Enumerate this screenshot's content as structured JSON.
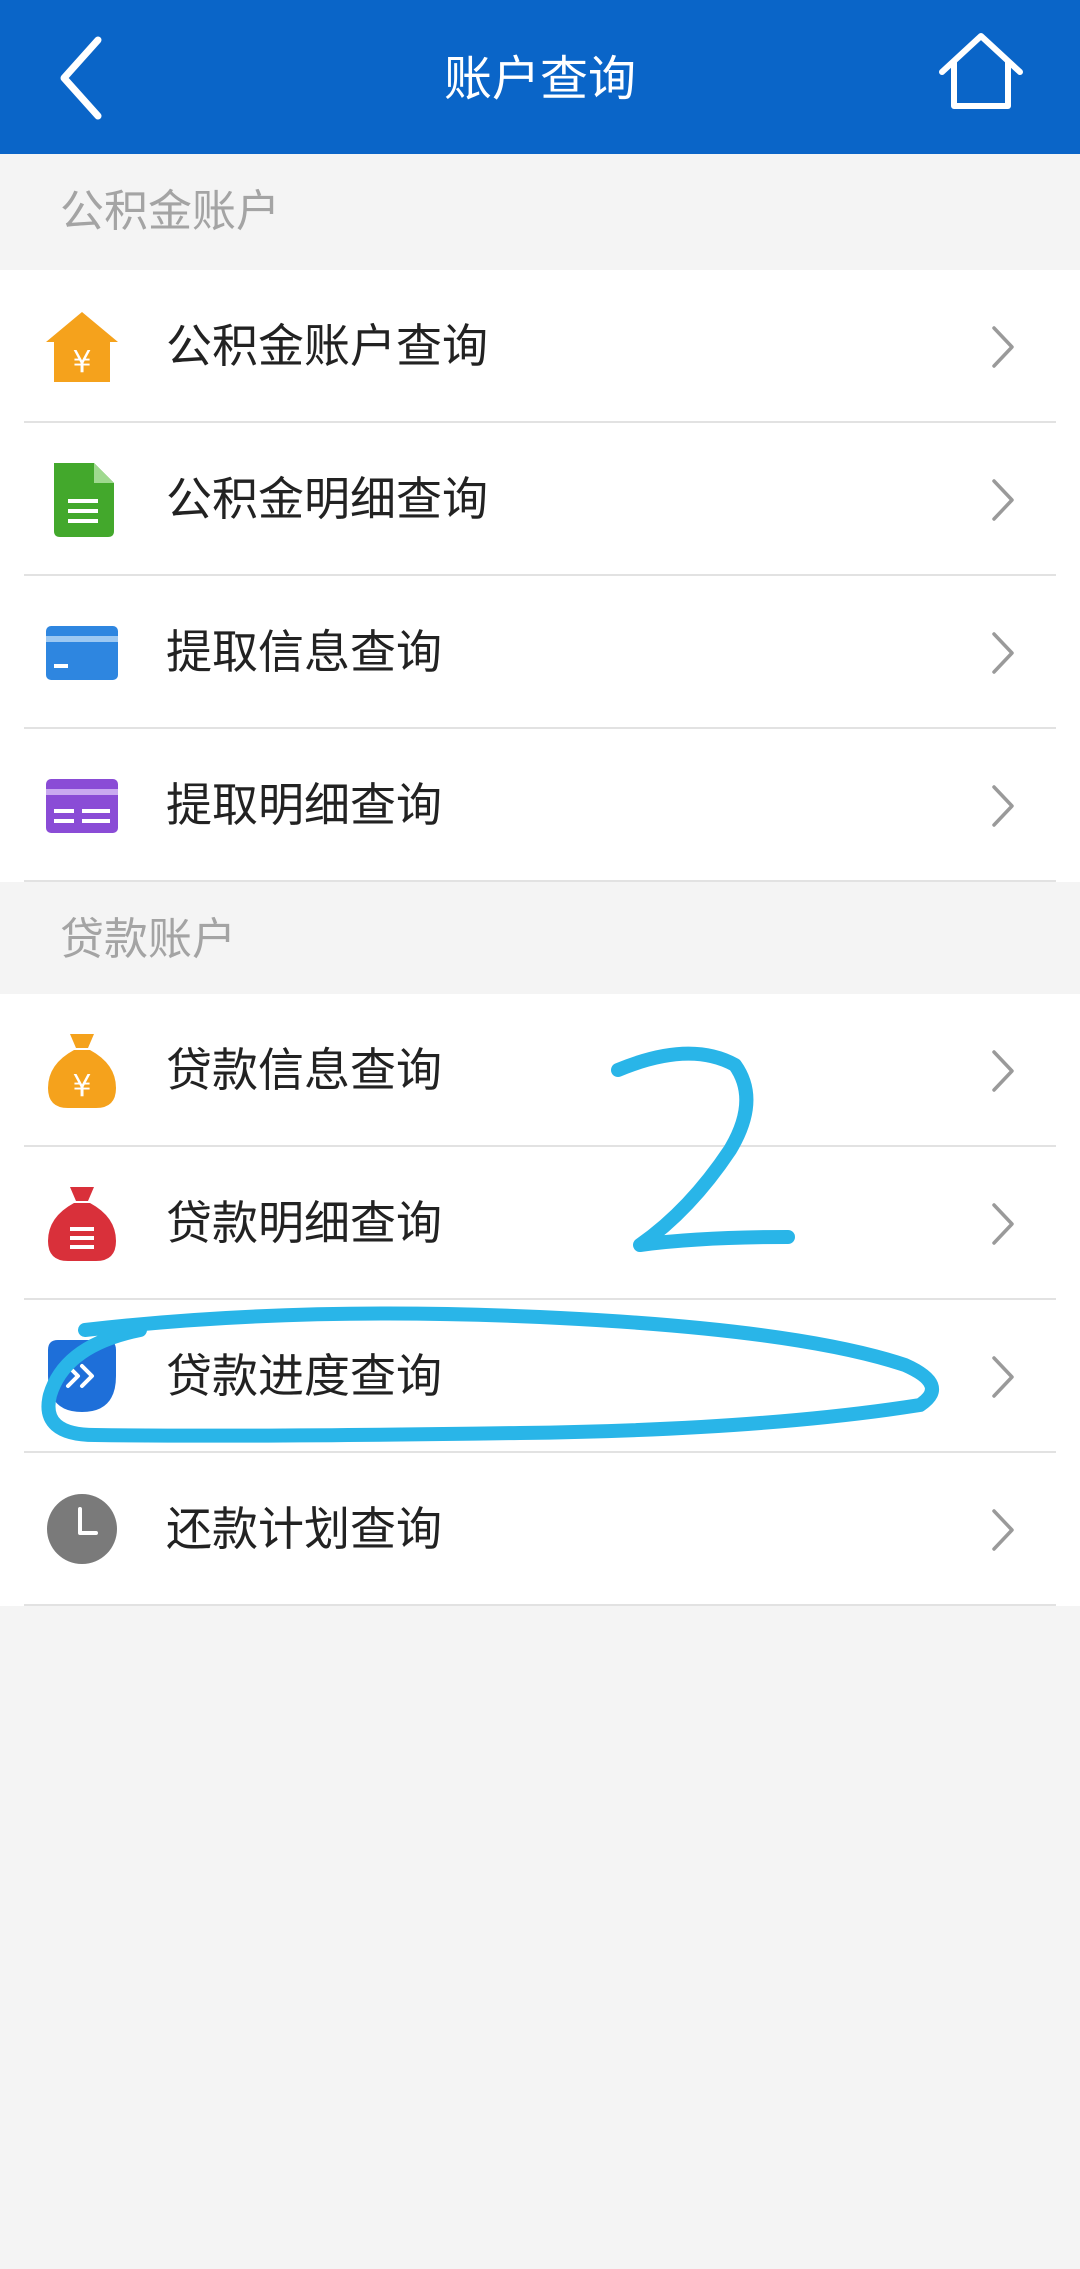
{
  "header": {
    "title": "账户查询"
  },
  "sections": [
    {
      "title": "公积金账户",
      "items": [
        {
          "label": "公积金账户查询",
          "icon": "house-yen-icon",
          "color": "#f5a21c"
        },
        {
          "label": "公积金明细查询",
          "icon": "document-icon",
          "color": "#43a82c"
        },
        {
          "label": "提取信息查询",
          "icon": "card-icon",
          "color": "#2e86e0"
        },
        {
          "label": "提取明细查询",
          "icon": "card-detail-icon",
          "color": "#8a4cd6"
        }
      ]
    },
    {
      "title": "贷款账户",
      "items": [
        {
          "label": "贷款信息查询",
          "icon": "money-bag-yen-icon",
          "color": "#f5a21c"
        },
        {
          "label": "贷款明细查询",
          "icon": "money-bag-list-icon",
          "color": "#d9303a"
        },
        {
          "label": "贷款进度查询",
          "icon": "progress-icon",
          "color": "#1e6fd9"
        },
        {
          "label": "还款计划查询",
          "icon": "clock-icon",
          "color": "#7a7a7a"
        }
      ]
    }
  ],
  "colors": {
    "header_bg": "#0a65c8",
    "annotation": "#29b5e8"
  },
  "annotation": {
    "text": "2"
  }
}
